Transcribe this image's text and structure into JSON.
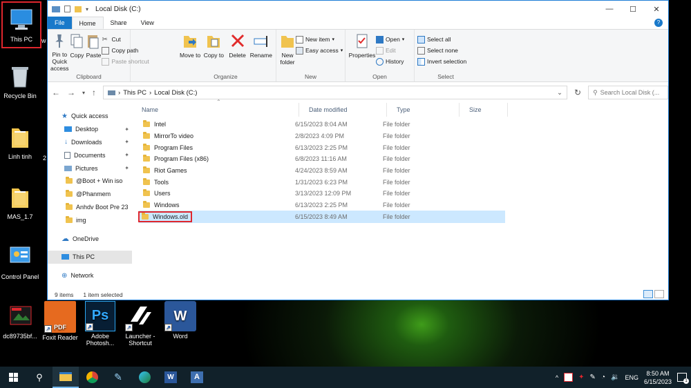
{
  "desktop": {
    "icons": [
      {
        "label": "This PC"
      },
      {
        "label": "Recycle Bin"
      },
      {
        "label": "Linh tinh"
      },
      {
        "label": "MAS_1.7"
      },
      {
        "label": "Control Panel"
      },
      {
        "label": "dc89735bf..."
      }
    ],
    "bottom_icons": [
      {
        "label": "Foxit Reader"
      },
      {
        "label": "Adobe Photosh..."
      },
      {
        "label": "Launcher - Shortcut"
      },
      {
        "label": "Word"
      }
    ],
    "partial": {
      "w": "w",
      "two": "2",
      "foxit_badge": "PDF",
      "ps": "Ps",
      "word": "W"
    }
  },
  "window": {
    "title": "Local Disk (C:)",
    "tabs": {
      "file": "File",
      "home": "Home",
      "share": "Share",
      "view": "View"
    },
    "ribbon": {
      "clipboard": {
        "pin": "Pin to Quick access",
        "copy": "Copy",
        "paste": "Paste",
        "cut": "Cut",
        "copy_path": "Copy path",
        "paste_shortcut": "Paste shortcut",
        "label": "Clipboard"
      },
      "organize": {
        "move_to": "Move to",
        "copy_to": "Copy to",
        "delete": "Delete",
        "rename": "Rename",
        "label": "Organize"
      },
      "new": {
        "new_folder": "New folder",
        "new_item": "New item",
        "easy_access": "Easy access",
        "label": "New"
      },
      "open": {
        "properties": "Properties",
        "open": "Open",
        "edit": "Edit",
        "history": "History",
        "label": "Open"
      },
      "select": {
        "select_all": "Select all",
        "select_none": "Select none",
        "invert": "Invert selection",
        "label": "Select"
      }
    },
    "address": {
      "crumb1": "This PC",
      "crumb2": "Local Disk (C:)",
      "search_placeholder": "Search Local Disk (..."
    },
    "nav": [
      {
        "label": "Quick access",
        "pin": ""
      },
      {
        "label": "Desktop",
        "pin": "✦"
      },
      {
        "label": "Downloads",
        "pin": "✦"
      },
      {
        "label": "Documents",
        "pin": "✦"
      },
      {
        "label": "Pictures",
        "pin": "✦"
      },
      {
        "label": "@Boot + Win iso",
        "pin": ""
      },
      {
        "label": "@Phanmem",
        "pin": ""
      },
      {
        "label": "Anhdv Boot Pre 23",
        "pin": ""
      },
      {
        "label": "img",
        "pin": ""
      },
      {
        "label": "OneDrive",
        "pin": ""
      },
      {
        "label": "This PC",
        "pin": ""
      },
      {
        "label": "Network",
        "pin": ""
      }
    ],
    "columns": {
      "name": "Name",
      "date": "Date modified",
      "type": "Type",
      "size": "Size"
    },
    "files": [
      {
        "name": "Intel",
        "date": "6/15/2023 8:04 AM",
        "type": "File folder"
      },
      {
        "name": "MirrorTo video",
        "date": "2/8/2023 4:09 PM",
        "type": "File folder"
      },
      {
        "name": "Program Files",
        "date": "6/13/2023 2:25 PM",
        "type": "File folder"
      },
      {
        "name": "Program Files (x86)",
        "date": "6/8/2023 11:16 AM",
        "type": "File folder"
      },
      {
        "name": "Riot Games",
        "date": "4/24/2023 8:59 AM",
        "type": "File folder"
      },
      {
        "name": "Tools",
        "date": "1/31/2023 6:23 PM",
        "type": "File folder"
      },
      {
        "name": "Users",
        "date": "3/13/2023 12:09 PM",
        "type": "File folder"
      },
      {
        "name": "Windows",
        "date": "6/13/2023 2:25 PM",
        "type": "File folder"
      },
      {
        "name": "Windows.old",
        "date": "6/15/2023 8:49 AM",
        "type": "File folder"
      }
    ],
    "status": {
      "count": "9 items",
      "selected": "1 item selected"
    }
  },
  "taskbar": {
    "lang": "ENG",
    "time": "8:50 AM",
    "date": "6/15/2023",
    "notif_count": "1",
    "app_a": "A",
    "word": "W",
    "caret": "^"
  },
  "colors": {
    "accent": "#1979ca",
    "highlight": "#e0262d",
    "selection": "#cce8ff"
  }
}
